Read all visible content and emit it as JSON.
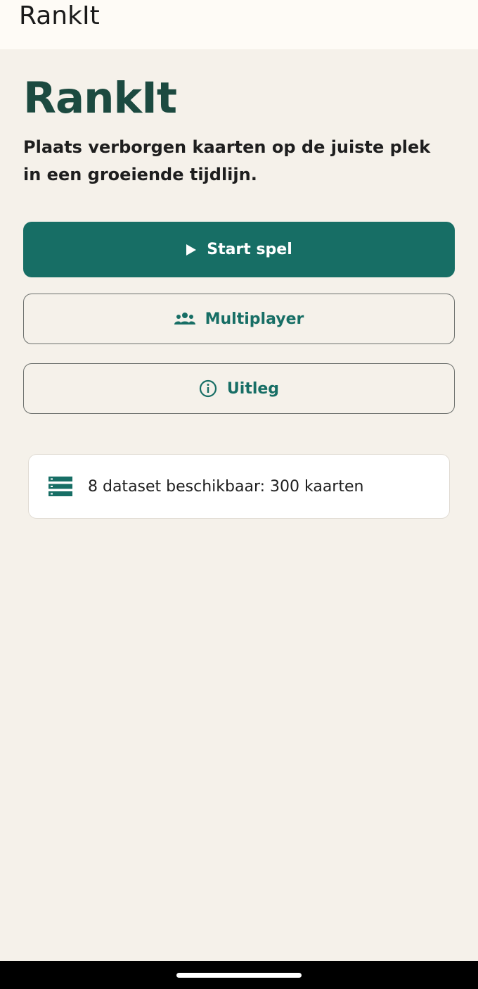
{
  "app_bar": {
    "title": "RankIt"
  },
  "hero": {
    "title": "RankIt",
    "subtitle": "Plaats verborgen kaarten op de juiste plek in een groeiende tijdlijn."
  },
  "actions": {
    "start": {
      "label": "Start spel",
      "icon": "play-icon"
    },
    "multiplayer": {
      "label": "Multiplayer",
      "icon": "group-icon"
    },
    "uitleg": {
      "label": "Uitleg",
      "icon": "info-icon"
    }
  },
  "dataset_info": {
    "icon": "storage-icon",
    "text": "8 dataset beschikbaar: 300 kaarten"
  },
  "colors": {
    "primary": "#176e65",
    "title": "#1c4a40",
    "background": "#f5f1ea",
    "app_bar": "#fefbf6"
  }
}
